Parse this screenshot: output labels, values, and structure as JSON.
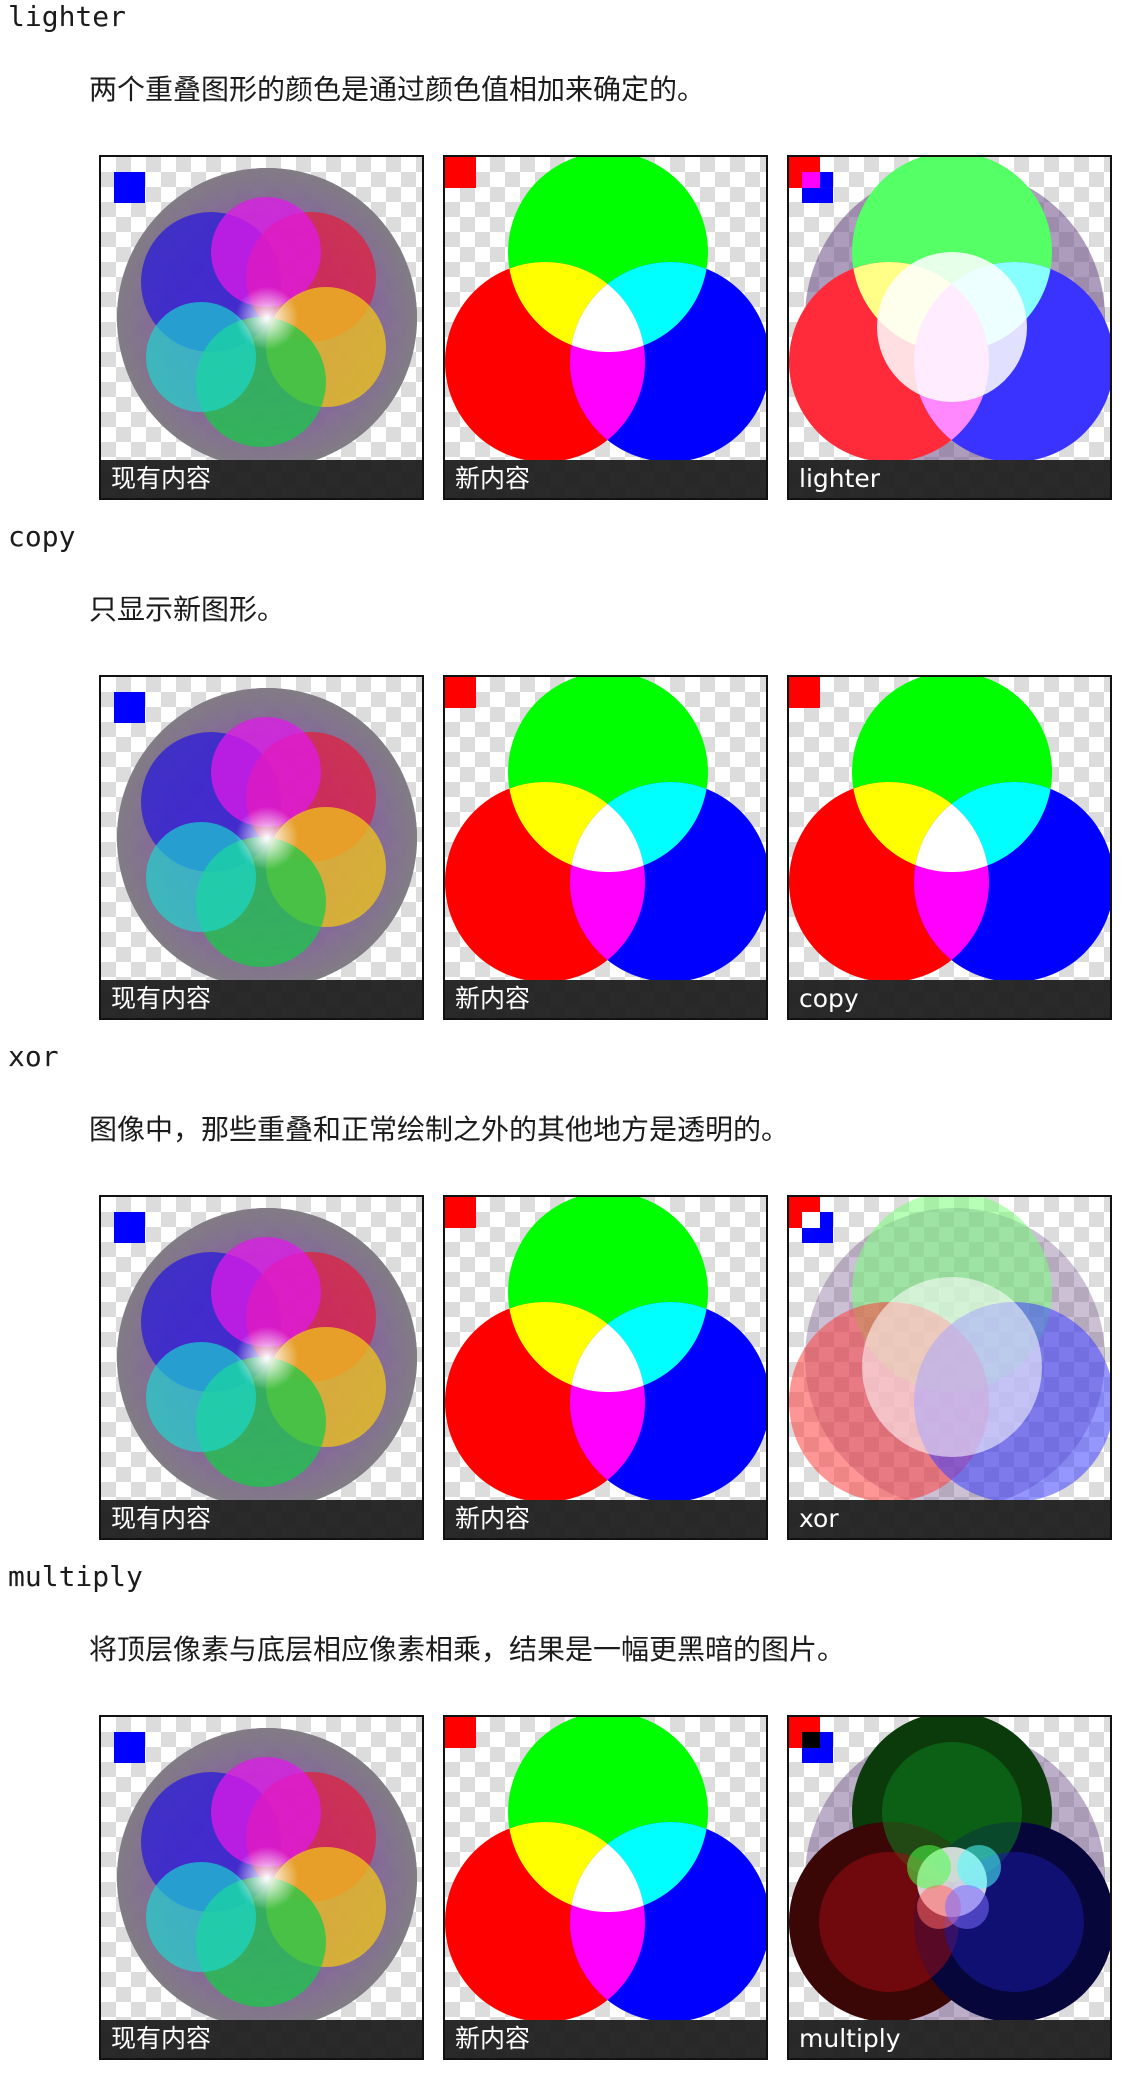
{
  "sections": [
    {
      "term": "lighter",
      "description": "两个重叠图形的颜色是通过颜色值相加来确定的。",
      "captions": {
        "existing": "现有内容",
        "new": "新内容",
        "result": "lighter"
      }
    },
    {
      "term": "copy",
      "description": "只显示新图形。",
      "captions": {
        "existing": "现有内容",
        "new": "新内容",
        "result": "copy"
      }
    },
    {
      "term": "xor",
      "description": "图像中，那些重叠和正常绘制之外的其他地方是透明的。",
      "captions": {
        "existing": "现有内容",
        "new": "新内容",
        "result": "xor"
      }
    },
    {
      "term": "multiply",
      "description": "将顶层像素与底层相应像素相乘，结果是一幅更黑暗的图片。",
      "captions": {
        "existing": "现有内容",
        "new": "新内容",
        "result": "multiply"
      }
    }
  ],
  "colors": {
    "red": "#ff0000",
    "green": "#00ff00",
    "blue": "#0000ff",
    "caption_bg": "#181818"
  }
}
